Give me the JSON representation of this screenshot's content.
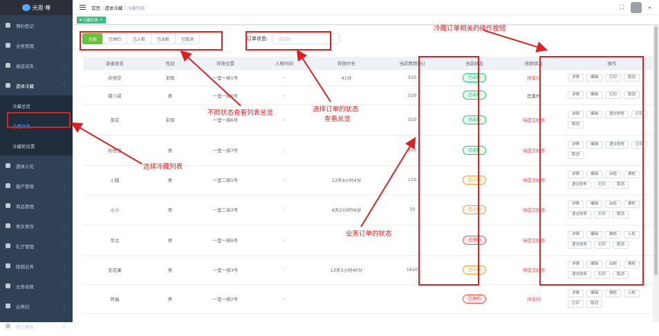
{
  "app": {
    "logo_text": "元思·尊",
    "logo_sub": "system"
  },
  "sidebar": {
    "items": [
      {
        "label": "预约登记",
        "icon": "calendar-icon",
        "arrow": false
      },
      {
        "label": "业务管理",
        "icon": "briefcase-icon",
        "arrow": true
      },
      {
        "label": "接运派车",
        "icon": "car-icon",
        "arrow": true
      },
      {
        "label": "遗体冷藏",
        "icon": "snowflake-icon",
        "arrow": true,
        "open": true
      },
      {
        "label": "冷藏总览",
        "sub": true
      },
      {
        "label": "冷藏列表",
        "sub": true,
        "active": true
      },
      {
        "label": "冷藏柜设置",
        "sub": true
      },
      {
        "label": "遗体火化",
        "icon": "fire-icon",
        "arrow": true
      },
      {
        "label": "客户管理",
        "icon": "user-icon",
        "arrow": true
      },
      {
        "label": "商品管理",
        "icon": "cart-icon",
        "arrow": true
      },
      {
        "label": "骨灰寄存",
        "icon": "grid-icon",
        "arrow": true
      },
      {
        "label": "礼厅管理",
        "icon": "hall-icon",
        "arrow": true
      },
      {
        "label": "陵园业务",
        "icon": "tree-icon",
        "arrow": true
      },
      {
        "label": "业务收款",
        "icon": "money-icon",
        "arrow": true
      },
      {
        "label": "云祭扫",
        "icon": "cloud-icon",
        "arrow": true
      },
      {
        "label": "统计报表",
        "icon": "chart-icon",
        "arrow": true
      }
    ]
  },
  "breadcrumb": {
    "home": "首页",
    "sep": "/",
    "parent": "遗体冷藏",
    "current": "冷藏列表"
  },
  "tabs": [
    {
      "label": "冷藏列表",
      "close": "×"
    }
  ],
  "filters": {
    "buttons": [
      "全部",
      "已预约",
      "已入柜",
      "已出柜",
      "已取消"
    ]
  },
  "order_status": {
    "label": "订单状态:",
    "placeholder": "请选择"
  },
  "table": {
    "headers": [
      "逝者姓名",
      "性别",
      "存放位置",
      "入柜时间",
      "存放时长",
      "当前费用(元)",
      "当前状态",
      "收款状态",
      "操作"
    ],
    "rows": [
      {
        "name": "孙悟空",
        "gender": "未知",
        "pos": "一室一排1号",
        "in": "-",
        "dur": "41分",
        "fee": "310",
        "status": "已出柜",
        "sc": "green",
        "pay": "待支付",
        "pc": "red",
        "ops": [
          "详情",
          "编辑",
          "打印",
          "取消"
        ]
      },
      {
        "name": "猪八戒",
        "gender": "男",
        "pos": "一室一排6号",
        "in": "-",
        "dur": "",
        "fee": "310",
        "status": "已出柜",
        "sc": "green",
        "pay": "已支付",
        "pc": "dark",
        "ops": [
          "详情",
          "编辑",
          "打印",
          "取消"
        ]
      },
      {
        "name": "菜花",
        "gender": "未知",
        "pos": "一室一排6号",
        "in": "-",
        "dur": "",
        "fee": "310",
        "status": "已出柜",
        "sc": "green",
        "pay": "待提交财务",
        "pc": "red",
        "ops": [
          "详情",
          "编辑",
          "递交财务",
          "打印",
          "取消"
        ]
      },
      {
        "name": "孙悟空",
        "gender": "男",
        "pos": "一室一排7号",
        "in": "-",
        "dur": "",
        "fee": "310",
        "status": "已出柜",
        "sc": "green",
        "pay": "待提交财务",
        "pc": "red",
        "ops": [
          "详情",
          "编辑",
          "递交财务",
          "打印",
          "取消"
        ]
      },
      {
        "name": "小猪",
        "gender": "男",
        "pos": "一室二排5号",
        "in": "-",
        "dur": "13天4小时4分",
        "fee": "110",
        "status": "已入柜",
        "sc": "yellow",
        "pay": "待提交财务",
        "pc": "red",
        "ops": [
          "详情",
          "编辑",
          "出柜",
          "换柜",
          "递交财务",
          "打印",
          "取消"
        ]
      },
      {
        "name": "小小",
        "gender": "男",
        "pos": "一室二排3号",
        "in": "-",
        "dur": "6天2小时56分",
        "fee": "70",
        "status": "已入柜",
        "sc": "yellow",
        "pay": "待提交财务",
        "pc": "red",
        "ops": [
          "详情",
          "编辑",
          "出柜",
          "换柜",
          "递交财务",
          "打印",
          "取消"
        ]
      },
      {
        "name": "华立",
        "gender": "男",
        "pos": "一室一排8号",
        "in": "-",
        "dur": "",
        "fee": "",
        "status": "已预约",
        "sc": "red",
        "pay": "待提交财务",
        "pc": "red",
        "ops": [
          "详情",
          "编辑",
          "换柜",
          "入柜",
          "递交财务",
          "打印",
          "取消"
        ]
      },
      {
        "name": "无花果",
        "gender": "男",
        "pos": "一室一排3号",
        "in": "-",
        "dur": "13天3小时40分",
        "fee": "1610",
        "status": "已入柜",
        "sc": "yellow",
        "pay": "待提交财务",
        "pc": "red",
        "ops": [
          "详情",
          "编辑",
          "出柜",
          "换柜",
          "递交财务",
          "打印",
          "取消"
        ]
      },
      {
        "name": "阿福",
        "gender": "男",
        "pos": "一室一排2号",
        "in": "-",
        "dur": "",
        "fee": "",
        "status": "已预约",
        "sc": "red",
        "pay": "待支付",
        "pc": "red",
        "ops": [
          "详情",
          "编辑",
          "换柜",
          "入柜",
          "打印",
          "取消"
        ]
      }
    ]
  },
  "annotations": {
    "ops_label": "冷藏订单相关的操作按钮",
    "filter_label": "不同状态查看列表总览",
    "order_label_1": "选择订单的状态",
    "order_label_2": "查看总览",
    "sidebar_label": "选择冷藏列表",
    "status_label": "业务订单的状态",
    "color": "#e02020"
  }
}
